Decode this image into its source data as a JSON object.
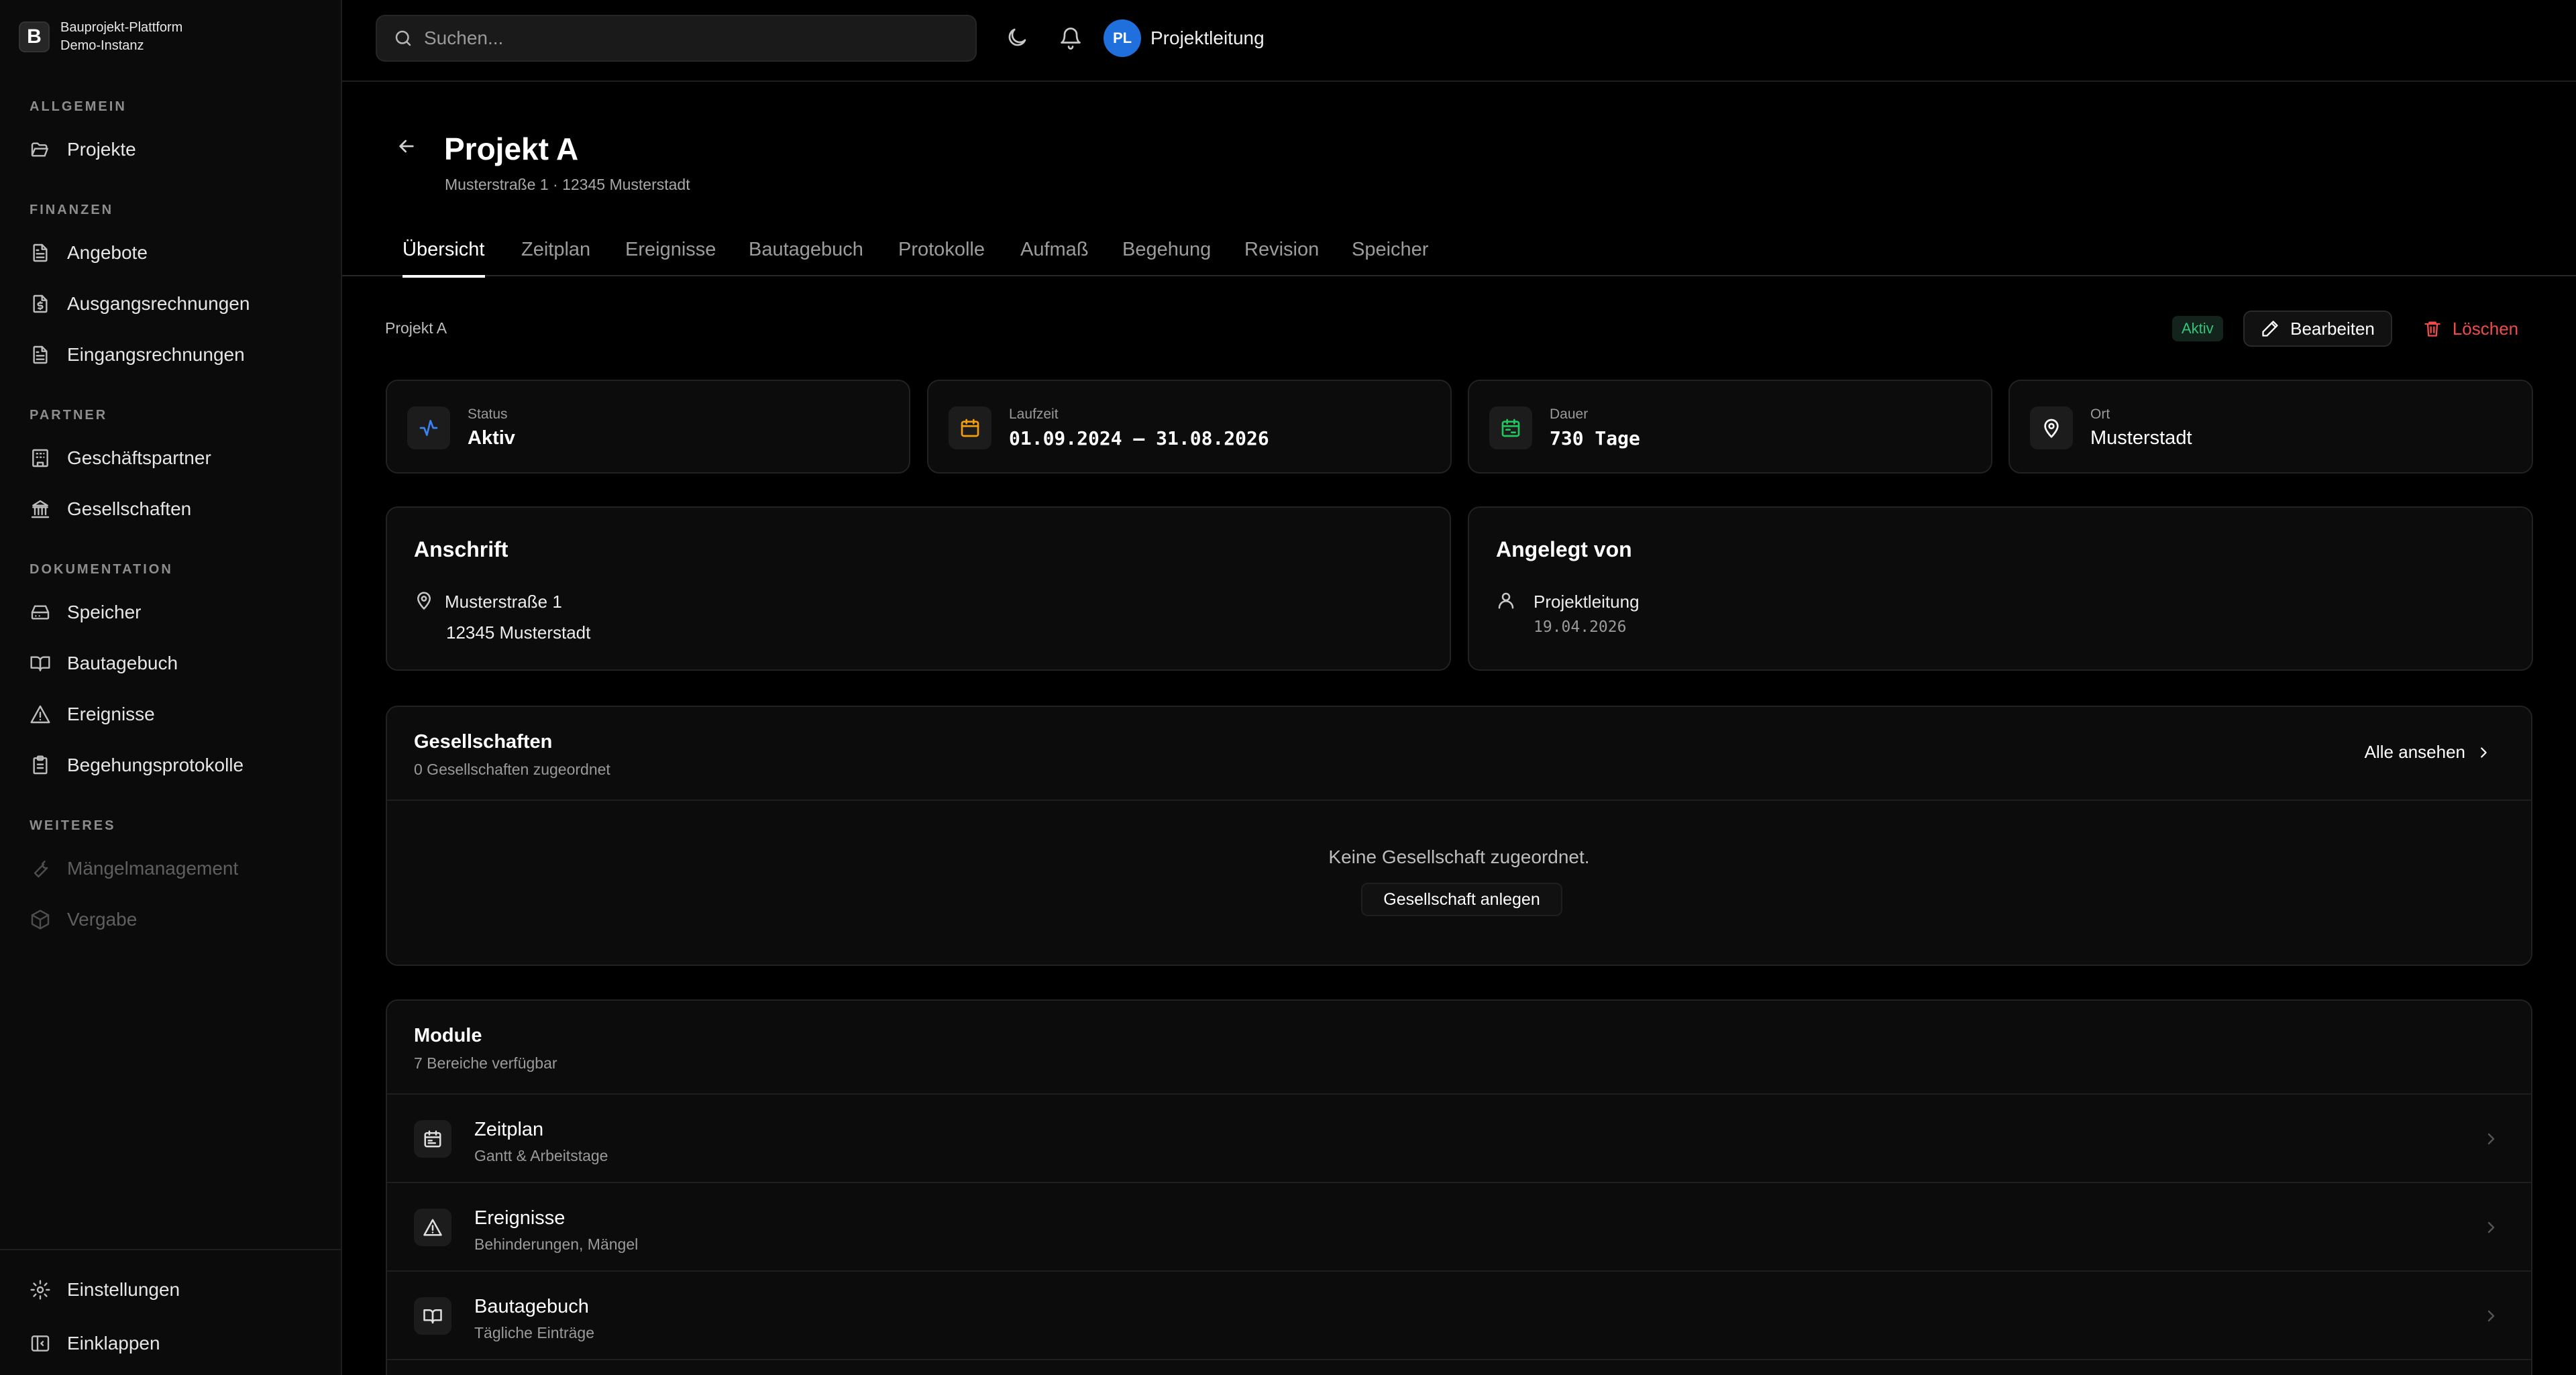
{
  "brand": {
    "logo_letter": "B",
    "name": "Bauprojekt-Plattform",
    "instance": "Demo-Instanz"
  },
  "sidebar": {
    "sections": [
      {
        "title": "ALLGEMEIN",
        "items": [
          {
            "label": "Projekte",
            "icon": "folder-open-icon"
          }
        ]
      },
      {
        "title": "FINANZEN",
        "items": [
          {
            "label": "Angebote",
            "icon": "file-text-icon"
          },
          {
            "label": "Ausgangsrechnungen",
            "icon": "invoice-icon"
          },
          {
            "label": "Eingangsrechnungen",
            "icon": "file-text-icon"
          }
        ]
      },
      {
        "title": "PARTNER",
        "items": [
          {
            "label": "Geschäftspartner",
            "icon": "building-icon"
          },
          {
            "label": "Gesellschaften",
            "icon": "landmark-icon"
          }
        ]
      },
      {
        "title": "DOKUMENTATION",
        "items": [
          {
            "label": "Speicher",
            "icon": "hard-drive-icon"
          },
          {
            "label": "Bautagebuch",
            "icon": "book-open-icon"
          },
          {
            "label": "Ereignisse",
            "icon": "warning-icon"
          },
          {
            "label": "Begehungsprotokolle",
            "icon": "clipboard-icon"
          }
        ]
      },
      {
        "title": "WEITERES",
        "items": [
          {
            "label": "Mängelmanagement",
            "icon": "wrench-icon",
            "disabled": true
          },
          {
            "label": "Vergabe",
            "icon": "package-icon",
            "disabled": true
          }
        ]
      }
    ],
    "bottom": [
      {
        "label": "Einstellungen",
        "icon": "gear-icon"
      },
      {
        "label": "Einklappen",
        "icon": "panel-collapse-icon"
      }
    ]
  },
  "topbar": {
    "search_placeholder": "Suchen...",
    "user_initials": "PL",
    "user_name": "Projektleitung"
  },
  "project": {
    "title": "Projekt A",
    "address_line": "Musterstraße 1 · 12345 Musterstadt",
    "breadcrumb": "Projekt A",
    "status_badge": "Aktiv",
    "edit_label": "Bearbeiten",
    "delete_label": "Löschen"
  },
  "tabs": [
    "Übersicht",
    "Zeitplan",
    "Ereignisse",
    "Bautagebuch",
    "Protokolle",
    "Aufmaß",
    "Begehung",
    "Revision",
    "Speicher"
  ],
  "active_tab": "Übersicht",
  "stats": [
    {
      "label": "Status",
      "value": "Aktiv",
      "icon": "activity-icon",
      "color": "#3b82f6"
    },
    {
      "label": "Laufzeit",
      "value": "01.09.2024 – 31.08.2026",
      "icon": "calendar-icon",
      "color": "#f59e0b"
    },
    {
      "label": "Dauer",
      "value": "730 Tage",
      "icon": "calendar-range-icon",
      "color": "#22c55e"
    },
    {
      "label": "Ort",
      "value": "Musterstadt",
      "icon": "map-pin-icon",
      "color": "#ffffff"
    }
  ],
  "anschrift": {
    "title": "Anschrift",
    "street": "Musterstraße 1",
    "city": "12345 Musterstadt"
  },
  "angelegt": {
    "title": "Angelegt von",
    "name": "Projektleitung",
    "date": "19.04.2026"
  },
  "gesellschaften": {
    "title": "Gesellschaften",
    "subtitle": "0 Gesellschaften zugeordnet",
    "view_all": "Alle ansehen",
    "empty": "Keine Gesellschaft zugeordnet.",
    "create_button": "Gesellschaft anlegen"
  },
  "module": {
    "title": "Module",
    "subtitle": "7 Bereiche verfügbar",
    "items": [
      {
        "title": "Zeitplan",
        "subtitle": "Gantt & Arbeitstage",
        "icon": "calendar-icon"
      },
      {
        "title": "Ereignisse",
        "subtitle": "Behinderungen, Mängel",
        "icon": "warning-icon"
      },
      {
        "title": "Bautagebuch",
        "subtitle": "Tägliche Einträge",
        "icon": "book-open-icon"
      }
    ]
  },
  "colors": {
    "accent_blue": "#1f6fdc",
    "success": "#34c47c",
    "danger": "#ef4b4b"
  }
}
